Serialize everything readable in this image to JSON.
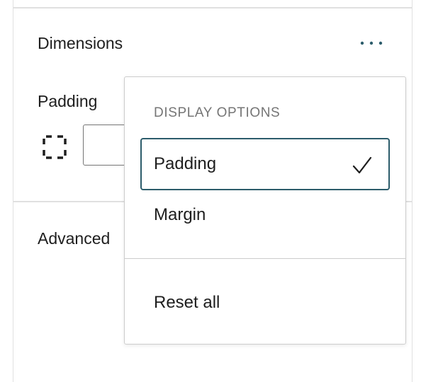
{
  "panels": {
    "dimensions": {
      "title": "Dimensions",
      "padding_label": "Padding",
      "padding_value": ""
    },
    "advanced": {
      "title": "Advanced"
    }
  },
  "icons": {
    "options": "ellipsis-icon",
    "padding_box": "box-sides-icon",
    "selected": "check-icon"
  },
  "dropdown": {
    "heading": "Display options",
    "items": [
      {
        "label": "Padding",
        "selected": true
      },
      {
        "label": "Margin",
        "selected": false
      }
    ],
    "reset_label": "Reset all"
  },
  "colors": {
    "accent": "#2c5c6b",
    "muted_text": "#757575",
    "border": "#e0e0e0"
  }
}
